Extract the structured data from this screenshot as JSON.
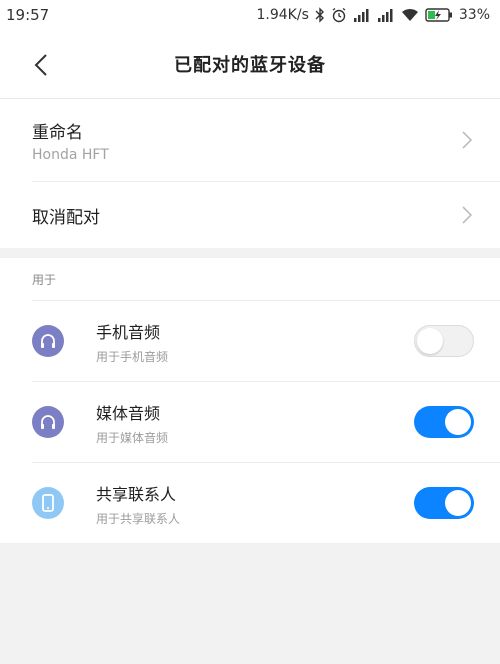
{
  "status": {
    "time": "19:57",
    "speed": "1.94K/s",
    "battery": "33%"
  },
  "header": {
    "title": "已配对的蓝牙设备"
  },
  "rename": {
    "label": "重命名",
    "value": "Honda HFT"
  },
  "unpair": {
    "label": "取消配对"
  },
  "usage": {
    "section_label": "用于",
    "items": [
      {
        "title": "手机音频",
        "subtitle": "用于手机音频",
        "icon": "headphones-icon",
        "enabled": false
      },
      {
        "title": "媒体音频",
        "subtitle": "用于媒体音频",
        "icon": "headphones-icon",
        "enabled": true
      },
      {
        "title": "共享联系人",
        "subtitle": "用于共享联系人",
        "icon": "phone-icon",
        "enabled": true
      }
    ]
  },
  "colors": {
    "accent": "#0d84ff",
    "headphone_icon_bg": "#7c7fc4",
    "phone_icon_bg": "#8fc8f4"
  }
}
